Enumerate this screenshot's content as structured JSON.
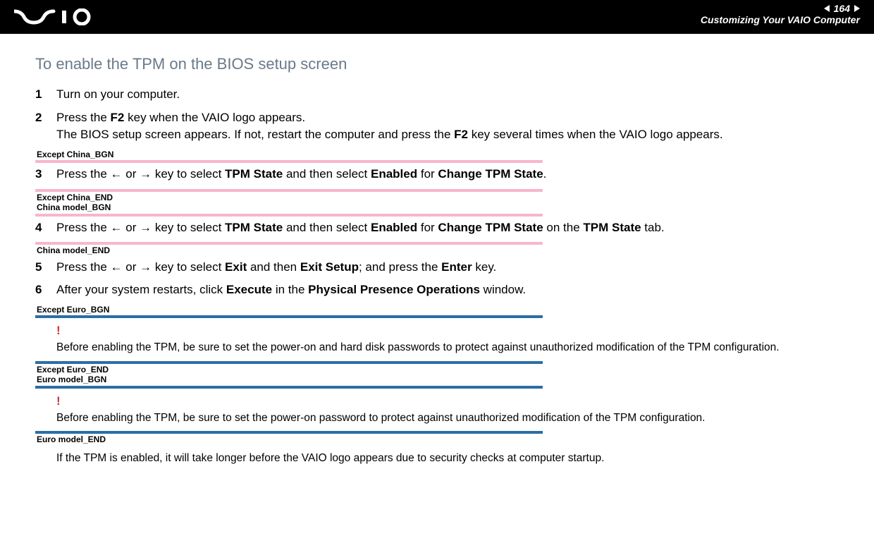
{
  "header": {
    "logo_text": "VAIO",
    "page_number": "164",
    "title": "Customizing Your VAIO Computer"
  },
  "heading": "To enable the TPM on the BIOS setup screen",
  "steps": {
    "s1_num": "1",
    "s1_text": "Turn on your computer.",
    "s2_num": "2",
    "s2_a": "Press the ",
    "s2_b": "F2",
    "s2_c": " key when the VAIO logo appears.",
    "s2_d": "The BIOS setup screen appears. If not, restart the computer and press the ",
    "s2_e": "F2",
    "s2_f": " key several times when the VAIO logo appears.",
    "s3_num": "3",
    "s3_a": "Press the ",
    "s3_left": "←",
    "s3_or": " or ",
    "s3_right": "→",
    "s3_b": " key to select ",
    "s3_c": "TPM State",
    "s3_d": " and then select ",
    "s3_e": "Enabled",
    "s3_f": " for ",
    "s3_g": "Change TPM State",
    "s3_h": ".",
    "s4_num": "4",
    "s4_a": "Press the ",
    "s4_left": "←",
    "s4_or": " or ",
    "s4_right": "→",
    "s4_b": " key to select ",
    "s4_c": "TPM State",
    "s4_d": " and then select ",
    "s4_e": "Enabled",
    "s4_f": " for ",
    "s4_g": "Change TPM State",
    "s4_h": " on the ",
    "s4_i": "TPM State",
    "s4_j": " tab.",
    "s5_num": "5",
    "s5_a": "Press the ",
    "s5_left": "←",
    "s5_or": " or ",
    "s5_right": "→",
    "s5_b": " key to select ",
    "s5_c": "Exit",
    "s5_d": " and then ",
    "s5_e": "Exit Setup",
    "s5_f": "; and press the ",
    "s5_g": "Enter",
    "s5_h": " key.",
    "s6_num": "6",
    "s6_a": "After your system restarts, click ",
    "s6_b": "Execute",
    "s6_c": " in the ",
    "s6_d": "Physical Presence Operations",
    "s6_e": " window."
  },
  "markers": {
    "except_china_bgn": "Except China_BGN",
    "except_china_end": "Except China_END",
    "china_model_bgn": "China model_BGN",
    "china_model_end": "China model_END",
    "except_euro_bgn": "Except Euro_BGN",
    "except_euro_end": "Except Euro_END",
    "euro_model_bgn": "Euro model_BGN",
    "euro_model_end": "Euro model_END"
  },
  "warnings": {
    "mark": "!",
    "w1": "Before enabling the TPM, be sure to set the power-on and hard disk passwords to protect against unauthorized modification of the TPM configuration.",
    "w2": "Before enabling the TPM, be sure to set the power-on password to protect against unauthorized modification of the TPM configuration."
  },
  "note": "If the TPM is enabled, it will take longer before the VAIO logo appears due to security checks at computer startup."
}
